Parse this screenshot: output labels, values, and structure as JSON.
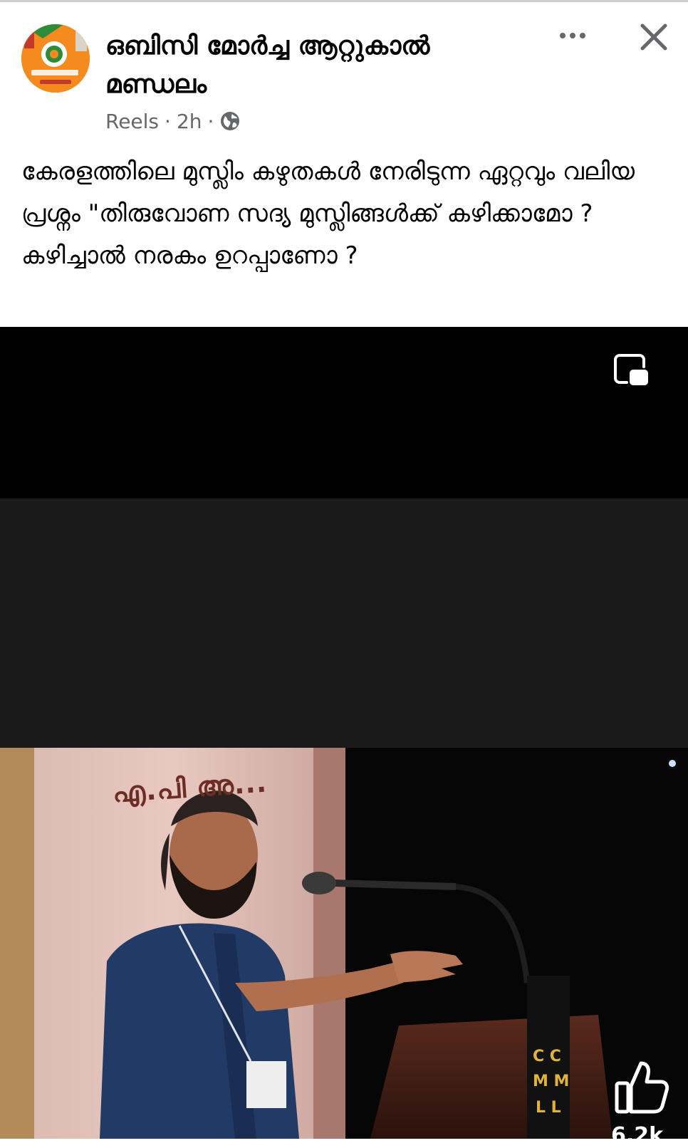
{
  "post": {
    "page_name": "ഒബിസി മോർച്ച ആറ്റുകാൽ മണ്ഡലം",
    "meta_type": "Reels",
    "meta_separator": "·",
    "meta_time": "2h",
    "text": "കേരളത്തിലെ മുസ്ലിം കഴുതകൾ നേരിടുന്ന ഏറ്റവും വലിയ പ്രശ്നം \"തിരുവോണ സദ്യ മുസ്ലിങ്ങൾക്ക് കഴിക്കാമോ ?കഴിച്ചാൽ നരകം ഉറപ്പാണോ ?"
  },
  "icons": {
    "more": "more-horizontal-icon",
    "close": "close-icon",
    "globe": "globe-icon",
    "pip": "picture-in-picture-icon",
    "like": "thumbs-up-icon"
  },
  "video": {
    "banner_text": "എ.പി അ...",
    "like_count": "6.2k"
  },
  "colors": {
    "accent_orange": "#f58a1f",
    "text_primary": "#050505",
    "text_secondary": "#65676b"
  }
}
